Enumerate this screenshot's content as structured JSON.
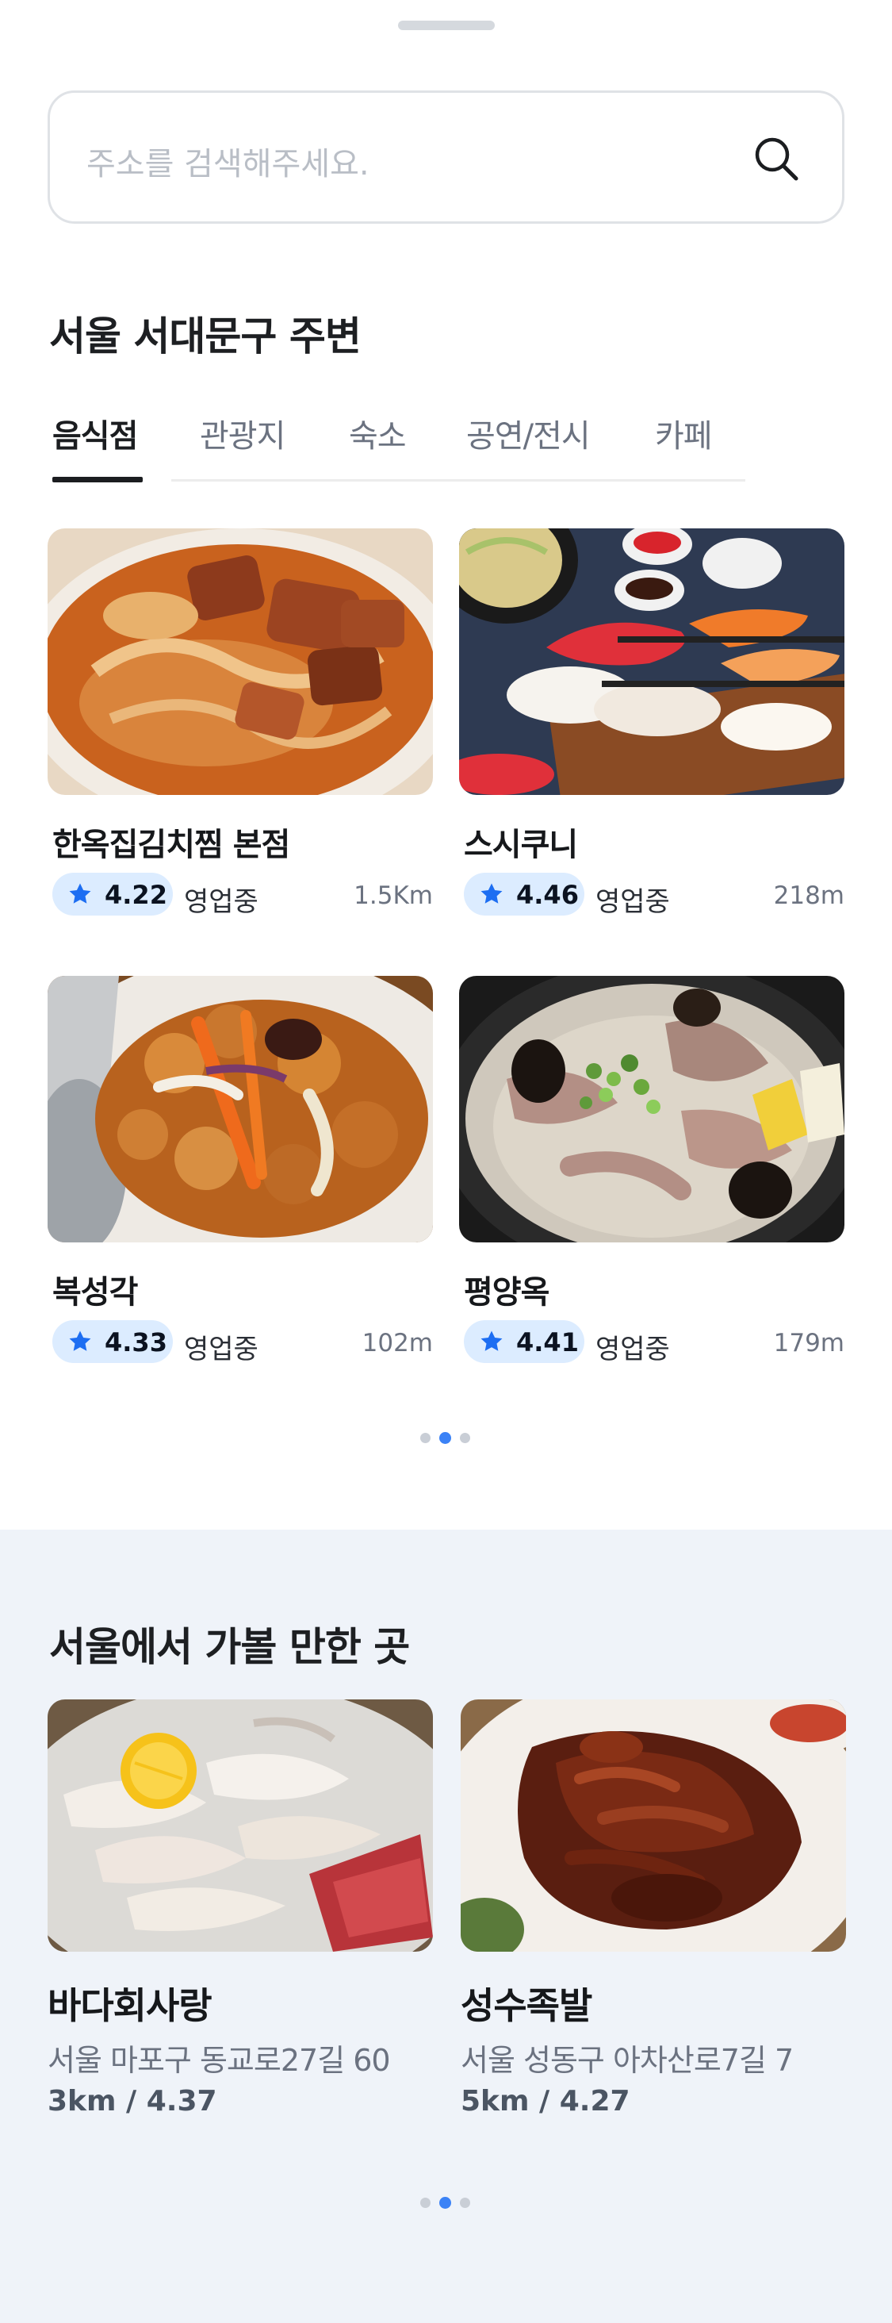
{
  "search": {
    "placeholder": "주소를 검색해주세요."
  },
  "nearby": {
    "title": "서울 서대문구 주변",
    "tabs": [
      {
        "label": "음식점",
        "active": true
      },
      {
        "label": "관광지",
        "active": false
      },
      {
        "label": "숙소",
        "active": false
      },
      {
        "label": "공연/전시",
        "active": false
      },
      {
        "label": "카페",
        "active": false
      }
    ],
    "places": [
      {
        "name": "한옥집김치찜 본점",
        "rating": "4.22",
        "status": "영업중",
        "distance": "1.5Km"
      },
      {
        "name": "스시쿠니",
        "rating": "4.46",
        "status": "영업중",
        "distance": "218m"
      },
      {
        "name": "복성각",
        "rating": "4.33",
        "status": "영업중",
        "distance": "102m"
      },
      {
        "name": "평양옥",
        "rating": "4.41",
        "status": "영업중",
        "distance": "179m"
      }
    ],
    "pager": {
      "count": 3,
      "active_index": 1
    }
  },
  "recommend": {
    "title": "서울에서 가볼 만한 곳",
    "places": [
      {
        "name": "바다회사랑",
        "address": "서울 마포구 동교로27길 60",
        "summary": "3km / 4.37"
      },
      {
        "name": "성수족발",
        "address": "서울 성동구 아차산로7길 7",
        "summary": "5km / 4.27"
      }
    ],
    "pager": {
      "count": 3,
      "active_index": 1
    }
  },
  "colors": {
    "accent": "#3b82f6",
    "rating_badge_bg": "#dcecff",
    "star": "#1d6ef2",
    "section_bg": "#eff3f9"
  },
  "icons": {
    "search": "search-icon",
    "star": "star-icon"
  }
}
